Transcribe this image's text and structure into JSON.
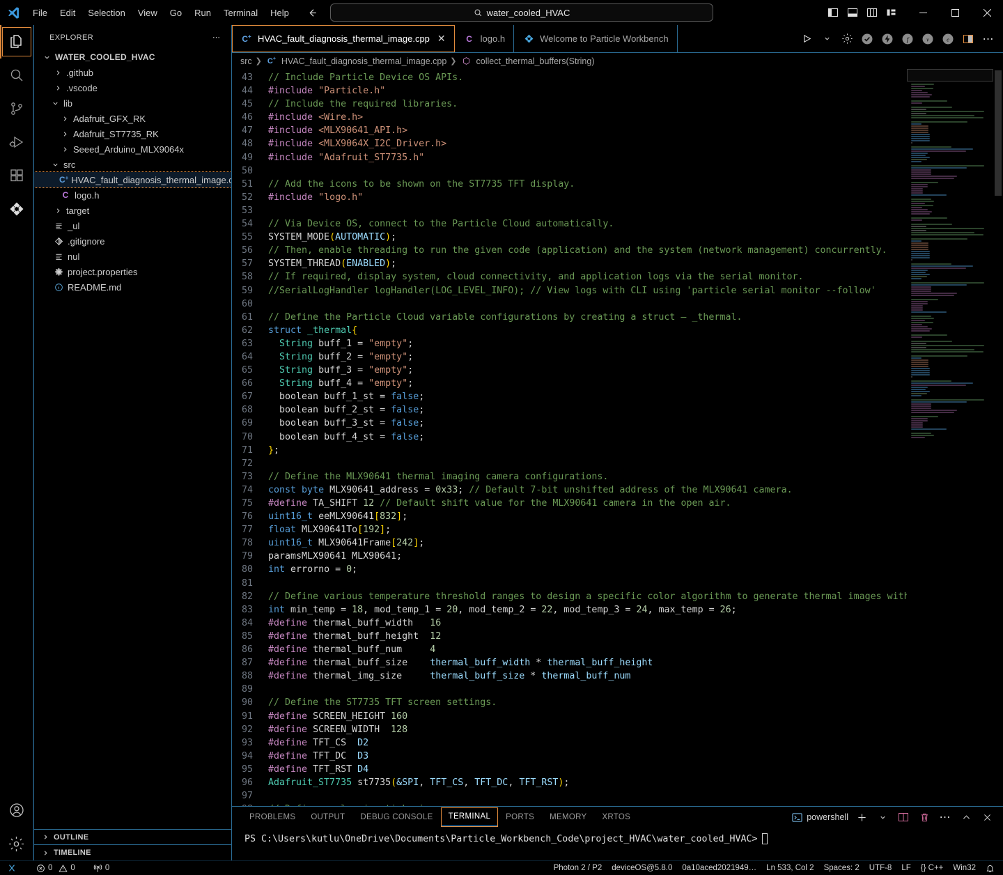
{
  "titlebar": {
    "logo_icon": "vscode-logo-icon",
    "menus": [
      "File",
      "Edit",
      "Selection",
      "View",
      "Go",
      "Run",
      "Terminal",
      "Help"
    ],
    "back_icon": "arrow-left-icon",
    "forward_icon": "arrow-right-icon",
    "search": {
      "icon": "search-icon",
      "value": "water_cooled_HVAC"
    },
    "layout_icons": [
      "toggle-primary-sidebar-icon",
      "toggle-panel-icon",
      "toggle-secondary-sidebar-icon",
      "customize-layout-icon"
    ],
    "window_controls": {
      "minimize": "—",
      "maximize": "☐",
      "close": "✕"
    }
  },
  "activitybar": {
    "items": [
      {
        "name": "explorer",
        "icon": "files-icon",
        "active": true
      },
      {
        "name": "search",
        "icon": "search-icon",
        "active": false
      },
      {
        "name": "source-control",
        "icon": "source-control-icon",
        "active": false
      },
      {
        "name": "run-and-debug",
        "icon": "run-debug-icon",
        "active": false
      },
      {
        "name": "extensions",
        "icon": "extensions-icon",
        "active": false
      },
      {
        "name": "particle-workbench",
        "icon": "particle-icon",
        "active": false
      }
    ],
    "bottom": [
      {
        "name": "accounts",
        "icon": "account-icon"
      },
      {
        "name": "manage",
        "icon": "gear-icon"
      }
    ]
  },
  "sidebar": {
    "header": {
      "title": "EXPLORER",
      "more_icon": "ellipsis-icon"
    },
    "root": {
      "label": "WATER_COOLED_HVAC",
      "expanded": true
    },
    "tree": [
      {
        "label": ".github",
        "indent": 1,
        "type": "folder",
        "state": "collapsed"
      },
      {
        "label": ".vscode",
        "indent": 1,
        "type": "folder",
        "state": "collapsed"
      },
      {
        "label": "lib",
        "indent": 1,
        "type": "folder",
        "state": "expanded"
      },
      {
        "label": "Adafruit_GFX_RK",
        "indent": 2,
        "type": "folder",
        "state": "collapsed"
      },
      {
        "label": "Adafruit_ST7735_RK",
        "indent": 2,
        "type": "folder",
        "state": "collapsed"
      },
      {
        "label": "Seeed_Arduino_MLX9064x",
        "indent": 2,
        "type": "folder",
        "state": "collapsed"
      },
      {
        "label": "src",
        "indent": 1,
        "type": "folder",
        "state": "expanded"
      },
      {
        "label": "HVAC_fault_diagnosis_thermal_image.cpp",
        "indent": 2,
        "type": "cpp",
        "state": "none",
        "selected": true
      },
      {
        "label": "logo.h",
        "indent": 2,
        "type": "header",
        "state": "none"
      },
      {
        "label": "target",
        "indent": 1,
        "type": "folder",
        "state": "collapsed"
      },
      {
        "label": "_ul",
        "indent": 1,
        "type": "text",
        "state": "none"
      },
      {
        "label": ".gitignore",
        "indent": 1,
        "type": "git",
        "state": "none"
      },
      {
        "label": "nul",
        "indent": 1,
        "type": "text",
        "state": "none"
      },
      {
        "label": "project.properties",
        "indent": 1,
        "type": "props",
        "state": "none"
      },
      {
        "label": "README.md",
        "indent": 1,
        "type": "md",
        "state": "none"
      }
    ],
    "sections": [
      {
        "label": "OUTLINE",
        "expanded": false
      },
      {
        "label": "TIMELINE",
        "expanded": false
      }
    ]
  },
  "tabs": [
    {
      "label": "HVAC_fault_diagnosis_thermal_image.cpp",
      "icon": "cpp-file-icon",
      "active": true,
      "close_icon": "close-icon"
    },
    {
      "label": "logo.h",
      "icon": "header-file-icon",
      "active": false
    },
    {
      "label": "Welcome to Particle Workbench",
      "icon": "particle-icon",
      "active": false
    }
  ],
  "editor_actions": [
    {
      "name": "run-button",
      "icon": "play-icon"
    },
    {
      "name": "run-dropdown",
      "icon": "chevron-down-icon"
    },
    {
      "name": "configure-button",
      "icon": "gear-icon"
    },
    {
      "name": "compile-check",
      "icon": "check-circle-icon"
    },
    {
      "name": "flash-button",
      "icon": "lightning-circle-icon"
    },
    {
      "name": "cloud-flash",
      "icon": "f-circle-icon"
    },
    {
      "name": "verify-button",
      "icon": "v-circle-icon"
    },
    {
      "name": "clean-button",
      "icon": "e-circle-icon"
    },
    {
      "name": "split-editor",
      "icon": "split-editor-icon"
    },
    {
      "name": "more-actions",
      "icon": "ellipsis-icon"
    }
  ],
  "breadcrumbs": [
    {
      "label": "src",
      "icon": null
    },
    {
      "label": "HVAC_fault_diagnosis_thermal_image.cpp",
      "icon": "cpp-file-icon"
    },
    {
      "label": "collect_thermal_buffers(String)",
      "icon": "method-icon"
    }
  ],
  "editor": {
    "first_line": 43,
    "lines": [
      {
        "n": 43,
        "t": "// Include Particle Device OS APIs."
      },
      {
        "n": 44,
        "t": "#include \"Particle.h\""
      },
      {
        "n": 45,
        "t": "// Include the required libraries."
      },
      {
        "n": 46,
        "t": "#include <Wire.h>"
      },
      {
        "n": 47,
        "t": "#include <MLX90641_API.h>"
      },
      {
        "n": 48,
        "t": "#include <MLX9064X_I2C_Driver.h>"
      },
      {
        "n": 49,
        "t": "#include \"Adafruit_ST7735.h\""
      },
      {
        "n": 50,
        "t": ""
      },
      {
        "n": 51,
        "t": "// Add the icons to be shown on the ST7735 TFT display."
      },
      {
        "n": 52,
        "t": "#include \"logo.h\""
      },
      {
        "n": 53,
        "t": ""
      },
      {
        "n": 54,
        "t": "// Via Device OS, connect to the Particle Cloud automatically."
      },
      {
        "n": 55,
        "t": "SYSTEM_MODE(AUTOMATIC);"
      },
      {
        "n": 56,
        "t": "// Then, enable threading to run the given code (application) and the system (network management) concurrently."
      },
      {
        "n": 57,
        "t": "SYSTEM_THREAD(ENABLED);"
      },
      {
        "n": 58,
        "t": "// If required, display system, cloud connectivity, and application logs via the serial monitor."
      },
      {
        "n": 59,
        "t": "//SerialLogHandler logHandler(LOG_LEVEL_INFO); // View logs with CLI using 'particle serial monitor --follow'"
      },
      {
        "n": 60,
        "t": ""
      },
      {
        "n": 61,
        "t": "// Define the Particle Cloud variable configurations by creating a struct — _thermal."
      },
      {
        "n": 62,
        "t": "struct _thermal{"
      },
      {
        "n": 63,
        "t": "  String buff_1 = \"empty\";"
      },
      {
        "n": 64,
        "t": "  String buff_2 = \"empty\";"
      },
      {
        "n": 65,
        "t": "  String buff_3 = \"empty\";"
      },
      {
        "n": 66,
        "t": "  String buff_4 = \"empty\";"
      },
      {
        "n": 67,
        "t": "  boolean buff_1_st = false;"
      },
      {
        "n": 68,
        "t": "  boolean buff_2_st = false;"
      },
      {
        "n": 69,
        "t": "  boolean buff_3_st = false;"
      },
      {
        "n": 70,
        "t": "  boolean buff_4_st = false;"
      },
      {
        "n": 71,
        "t": "};"
      },
      {
        "n": 72,
        "t": ""
      },
      {
        "n": 73,
        "t": "// Define the MLX90641 thermal imaging camera configurations."
      },
      {
        "n": 74,
        "t": "const byte MLX90641_address = 0x33; // Default 7-bit unshifted address of the MLX90641 camera."
      },
      {
        "n": 75,
        "t": "#define TA_SHIFT 12 // Default shift value for the MLX90641 camera in the open air."
      },
      {
        "n": 76,
        "t": "uint16_t eeMLX90641[832];"
      },
      {
        "n": 77,
        "t": "float MLX90641To[192];"
      },
      {
        "n": 78,
        "t": "uint16_t MLX90641Frame[242];"
      },
      {
        "n": 79,
        "t": "paramsMLX90641 MLX90641;"
      },
      {
        "n": 80,
        "t": "int errorno = 0;"
      },
      {
        "n": 81,
        "t": ""
      },
      {
        "n": 82,
        "t": "// Define various temperature threshold ranges to design a specific color algorithm to generate thermal images within"
      },
      {
        "n": 83,
        "t": "int min_temp = 18, mod_temp_1 = 20, mod_temp_2 = 22, mod_temp_3 = 24, max_temp = 26;"
      },
      {
        "n": 84,
        "t": "#define thermal_buff_width   16"
      },
      {
        "n": 85,
        "t": "#define thermal_buff_height  12"
      },
      {
        "n": 86,
        "t": "#define thermal_buff_num     4"
      },
      {
        "n": 87,
        "t": "#define thermal_buff_size    thermal_buff_width * thermal_buff_height"
      },
      {
        "n": 88,
        "t": "#define thermal_img_size     thermal_buff_size * thermal_buff_num"
      },
      {
        "n": 89,
        "t": ""
      },
      {
        "n": 90,
        "t": "// Define the ST7735 TFT screen settings."
      },
      {
        "n": 91,
        "t": "#define SCREEN_HEIGHT 160"
      },
      {
        "n": 92,
        "t": "#define SCREEN_WIDTH  128"
      },
      {
        "n": 93,
        "t": "#define TFT_CS  D2"
      },
      {
        "n": 94,
        "t": "#define TFT_DC  D3"
      },
      {
        "n": 95,
        "t": "#define TFT_RST D4"
      },
      {
        "n": 96,
        "t": "Adafruit_ST7735 st7735(&SPI, TFT_CS, TFT_DC, TFT_RST);"
      },
      {
        "n": 97,
        "t": ""
      },
      {
        "n": 98,
        "t": "// Define analog joystick pins."
      }
    ]
  },
  "panel": {
    "tabs": [
      {
        "label": "PROBLEMS",
        "active": false
      },
      {
        "label": "OUTPUT",
        "active": false
      },
      {
        "label": "DEBUG CONSOLE",
        "active": false
      },
      {
        "label": "TERMINAL",
        "active": true
      },
      {
        "label": "PORTS",
        "active": false
      },
      {
        "label": "MEMORY",
        "active": false
      },
      {
        "label": "XRTOS",
        "active": false
      }
    ],
    "terminal_name": "powershell",
    "terminal_icon": "terminal-powershell-icon",
    "actions": [
      {
        "name": "new-terminal-button",
        "icon": "plus-icon"
      },
      {
        "name": "terminal-type-dropdown",
        "icon": "chevron-down-icon"
      },
      {
        "name": "split-terminal-button",
        "icon": "split-icon"
      },
      {
        "name": "kill-terminal-button",
        "icon": "trash-icon"
      },
      {
        "name": "panel-more-actions",
        "icon": "ellipsis-icon"
      },
      {
        "name": "maximize-panel-button",
        "icon": "chevron-up-icon"
      },
      {
        "name": "close-panel-button",
        "icon": "close-icon"
      }
    ],
    "prompt": "PS C:\\Users\\kutlu\\OneDrive\\Documents\\Particle_Workbench_Code\\project_HVAC\\water_cooled_HVAC>"
  },
  "statusbar": {
    "left": [
      {
        "name": "remote-indicator",
        "icon": "remote-icon",
        "label": ""
      },
      {
        "name": "problems-errors",
        "icon": "error-icon",
        "label": "0"
      },
      {
        "name": "problems-warnings",
        "icon": "warning-icon",
        "label": "0"
      },
      {
        "name": "ports-status",
        "icon": "radio-tower-icon",
        "label": "0"
      }
    ],
    "right": [
      {
        "name": "device-target",
        "label": "Photon 2 / P2"
      },
      {
        "name": "device-os",
        "label": "deviceOS@5.8.0"
      },
      {
        "name": "device-id",
        "label": "0a10aced2021949…"
      },
      {
        "name": "cursor-position",
        "label": "Ln 533, Col 2"
      },
      {
        "name": "indentation",
        "label": "Spaces: 2"
      },
      {
        "name": "encoding",
        "label": "UTF-8"
      },
      {
        "name": "eol",
        "label": "LF"
      },
      {
        "name": "language-mode",
        "label": "{} C++"
      },
      {
        "name": "platform",
        "label": "Win32"
      },
      {
        "name": "notifications",
        "label": "",
        "icon": "bell-icon"
      }
    ]
  },
  "colors": {
    "accent_orange": "#e08a3c",
    "accent_blue": "#2a6b93",
    "background": "#000000",
    "comment_green": "#6A9955",
    "preproc_purple": "#C586C0",
    "string_orange": "#CE9178",
    "keyword_blue": "#569CD6",
    "type_teal": "#4EC9B0"
  }
}
